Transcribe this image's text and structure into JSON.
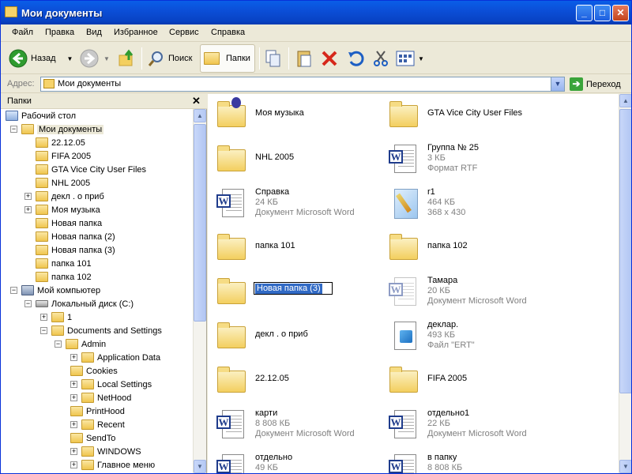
{
  "window": {
    "title": "Мои документы",
    "min": "_",
    "max": "□",
    "close": "✕"
  },
  "menu": [
    "Файл",
    "Правка",
    "Вид",
    "Избранное",
    "Сервис",
    "Справка"
  ],
  "toolbar": {
    "back": "Назад",
    "search": "Поиск",
    "folders": "Папки"
  },
  "address": {
    "label": "Адрес:",
    "value": "Мои документы",
    "go": "Переход"
  },
  "tree": {
    "header": "Папки",
    "close": "✕",
    "items": [
      {
        "label": "Рабочий стол",
        "pm": "",
        "icon": "desktop-icon"
      },
      {
        "label": "Мои документы",
        "pm": "−",
        "icon": "folder-icon"
      },
      {
        "label": "22.12.05",
        "pm": "",
        "icon": "folder-icon"
      },
      {
        "label": "FIFA 2005",
        "pm": "",
        "icon": "folder-icon"
      },
      {
        "label": "GTA Vice City User Files",
        "pm": "",
        "icon": "folder-icon"
      },
      {
        "label": "NHL 2005",
        "pm": "",
        "icon": "folder-icon"
      },
      {
        "label": "декл . о приб",
        "pm": "+",
        "icon": "folder-icon"
      },
      {
        "label": "Моя музыка",
        "pm": "+",
        "icon": "music-folder-icon"
      },
      {
        "label": "Новая папка",
        "pm": "",
        "icon": "folder-icon"
      },
      {
        "label": "Новая папка (2)",
        "pm": "",
        "icon": "folder-icon"
      },
      {
        "label": "Новая папка (3)",
        "pm": "",
        "icon": "folder-icon"
      },
      {
        "label": "папка 101",
        "pm": "",
        "icon": "folder-icon"
      },
      {
        "label": "папка 102",
        "pm": "",
        "icon": "folder-icon"
      },
      {
        "label": "Мой компьютер",
        "pm": "−",
        "icon": "computer-icon"
      },
      {
        "label": "Локальный диск (C:)",
        "pm": "−",
        "icon": "disk-icon"
      },
      {
        "label": "1",
        "pm": "+",
        "icon": "folder-icon"
      },
      {
        "label": "Documents and Settings",
        "pm": "−",
        "icon": "folder-icon"
      },
      {
        "label": "Admin",
        "pm": "−",
        "icon": "folder-icon"
      },
      {
        "label": "Application Data",
        "pm": "+",
        "icon": "folder-icon"
      },
      {
        "label": "Cookies",
        "pm": "",
        "icon": "folder-icon"
      },
      {
        "label": "Local Settings",
        "pm": "+",
        "icon": "folder-icon"
      },
      {
        "label": "NetHood",
        "pm": "+",
        "icon": "folder-icon"
      },
      {
        "label": "PrintHood",
        "pm": "",
        "icon": "folder-icon"
      },
      {
        "label": "Recent",
        "pm": "+",
        "icon": "folder-icon"
      },
      {
        "label": "SendTo",
        "pm": "",
        "icon": "folder-icon"
      },
      {
        "label": "WINDOWS",
        "pm": "+",
        "icon": "folder-icon"
      },
      {
        "label": "Главное меню",
        "pm": "+",
        "icon": "folder-icon"
      }
    ]
  },
  "files": [
    {
      "name": "Моя музыка",
      "type": "music-folder",
      "l2": "",
      "l3": ""
    },
    {
      "name": "GTA Vice City User Files",
      "type": "folder",
      "l2": "",
      "l3": ""
    },
    {
      "name": "NHL 2005",
      "type": "folder",
      "l2": "",
      "l3": ""
    },
    {
      "name": "Группа № 25",
      "type": "word",
      "l2": "3 КБ",
      "l3": "Формат RTF"
    },
    {
      "name": "Справка",
      "type": "word",
      "l2": "24 КБ",
      "l3": "Документ Microsoft Word"
    },
    {
      "name": "r1",
      "type": "image",
      "l2": "464 КБ",
      "l3": "368 x 430"
    },
    {
      "name": "папка 101",
      "type": "folder",
      "l2": "",
      "l3": ""
    },
    {
      "name": "папка 102",
      "type": "folder",
      "l2": "",
      "l3": ""
    },
    {
      "name": "Новая папка (3)",
      "type": "folder-rename",
      "l2": "",
      "l3": ""
    },
    {
      "name": "Тамара",
      "type": "word-faded",
      "l2": "20 КБ",
      "l3": "Документ Microsoft Word"
    },
    {
      "name": "декл . о приб",
      "type": "folder",
      "l2": "",
      "l3": ""
    },
    {
      "name": "деклар.",
      "type": "ert",
      "l2": "493 КБ",
      "l3": "Файл \"ERT\""
    },
    {
      "name": "22.12.05",
      "type": "folder",
      "l2": "",
      "l3": ""
    },
    {
      "name": "FIFA 2005",
      "type": "folder",
      "l2": "",
      "l3": ""
    },
    {
      "name": "карти",
      "type": "word",
      "l2": "8 808 КБ",
      "l3": "Документ Microsoft Word"
    },
    {
      "name": "отдельно1",
      "type": "word",
      "l2": "22 КБ",
      "l3": "Документ Microsoft Word"
    },
    {
      "name": "отдельно",
      "type": "word",
      "l2": "49 КБ",
      "l3": ""
    },
    {
      "name": "в папку",
      "type": "word",
      "l2": "8 808 КБ",
      "l3": ""
    }
  ]
}
